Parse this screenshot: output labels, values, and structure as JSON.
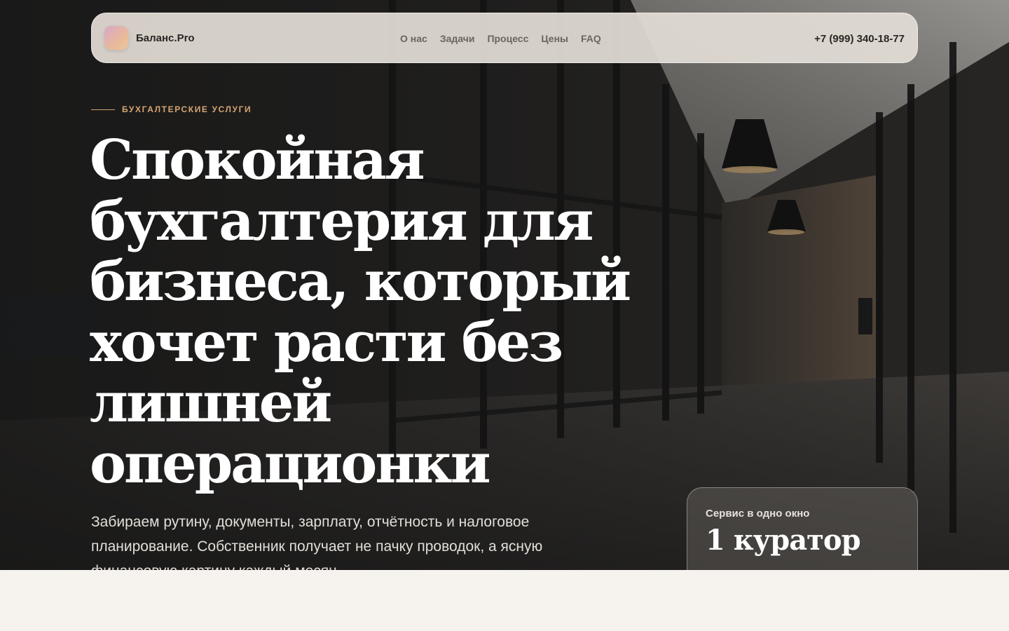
{
  "header": {
    "brand": "Баланс.Pro",
    "nav": [
      "О нас",
      "Задачи",
      "Процесс",
      "Цены",
      "FAQ"
    ],
    "phone": "+7 (999) 340-18-77"
  },
  "hero": {
    "eyebrow": "БУХГАЛТЕРСКИЕ УСЛУГИ",
    "headline_lines": [
      "Спокойная",
      "бухгалтерия для",
      "бизнеса, который",
      "хочет расти без",
      "лишней",
      "операционки"
    ],
    "lead_lines": [
      "Забираем рутину, документы, зарплату, отчётность и налоговое",
      "планирование. Собственник получает не пачку проводок, а ясную",
      "финансовую картину каждый месяц."
    ]
  },
  "stat_card": {
    "label": "Сервис в одно окно",
    "value": "1 куратор"
  },
  "colors": {
    "accent": "#d6a574",
    "page_background": "#f6f3ee",
    "navbar_background": "#e2ddd5"
  },
  "icons": {
    "logo": "gradient-rounded-square"
  }
}
